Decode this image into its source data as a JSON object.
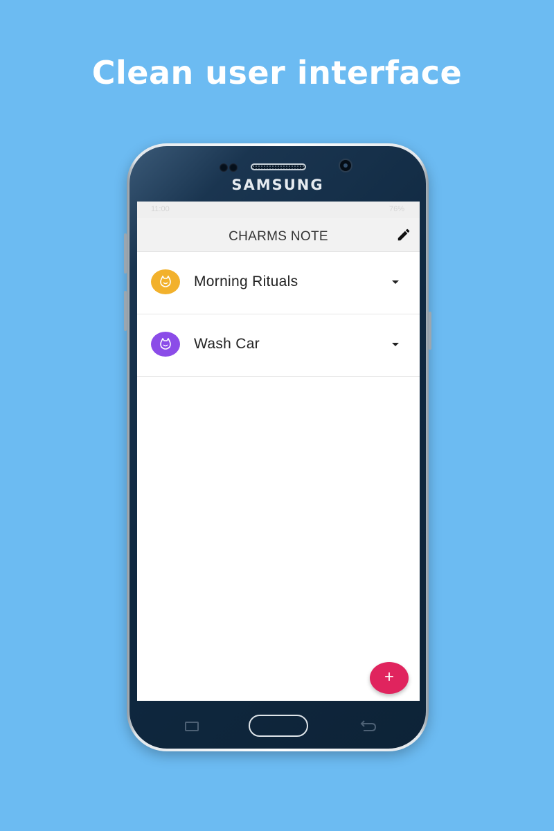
{
  "headline": "Clean user interface",
  "device": {
    "brand": "SAMSUNG"
  },
  "status_bar": {
    "time": "11:00",
    "right": "76%"
  },
  "app_bar": {
    "title": "CHARMS NOTE",
    "action_icon": "pencil-edit-icon"
  },
  "notes": [
    {
      "label": "Morning Rituals",
      "icon": "cat-face-icon",
      "color": "#f2b12c"
    },
    {
      "label": "Wash Car",
      "icon": "cat-face-icon",
      "color": "#8b4ce8"
    }
  ],
  "fab": {
    "label": "+",
    "color": "#e0245e"
  },
  "colors": {
    "background": "#6cbbf2",
    "phone_body": "#0f2840"
  }
}
